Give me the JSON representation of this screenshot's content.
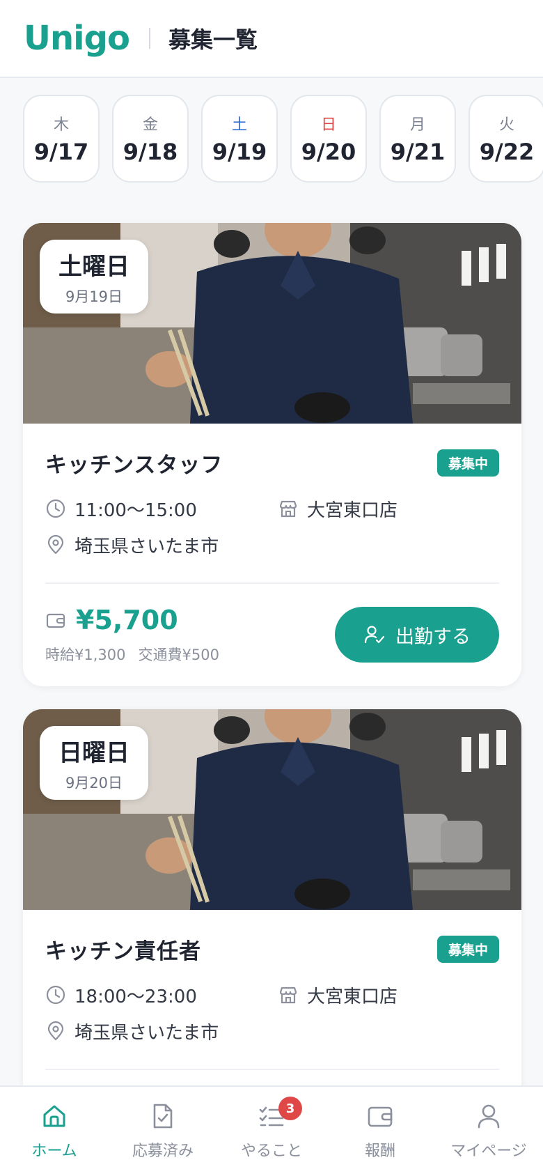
{
  "header": {
    "logo": "Unigo",
    "title": "募集一覧"
  },
  "dates": [
    {
      "dow": "木",
      "md": "9/17",
      "kind": "weekday"
    },
    {
      "dow": "金",
      "md": "9/18",
      "kind": "weekday"
    },
    {
      "dow": "土",
      "md": "9/19",
      "kind": "sat"
    },
    {
      "dow": "日",
      "md": "9/20",
      "kind": "sun"
    },
    {
      "dow": "月",
      "md": "9/21",
      "kind": "weekday"
    },
    {
      "dow": "火",
      "md": "9/22",
      "kind": "weekday"
    }
  ],
  "jobs": [
    {
      "weekday": "土曜日",
      "date": "9月19日",
      "title": "キッチンスタッフ",
      "status": "募集中",
      "time": "11:00〜15:00",
      "store": "大宮東口店",
      "location": "埼玉県さいたま市",
      "total": "¥5,700",
      "hourly": "時給¥1,300",
      "transport": "交通費¥500",
      "action": "出勤する"
    },
    {
      "weekday": "日曜日",
      "date": "9月20日",
      "title": "キッチン責任者",
      "status": "募集中",
      "time": "18:00〜23:00",
      "store": "大宮東口店",
      "location": "埼玉県さいたま市"
    }
  ],
  "nav": {
    "home": "ホーム",
    "applied": "応募済み",
    "todo": "やること",
    "todo_badge": "3",
    "reward": "報酬",
    "mypage": "マイページ"
  },
  "colors": {
    "accent": "#1aa08f",
    "saturday": "#2f6fd6",
    "sunday": "#e04848",
    "badge": "#e04848"
  }
}
